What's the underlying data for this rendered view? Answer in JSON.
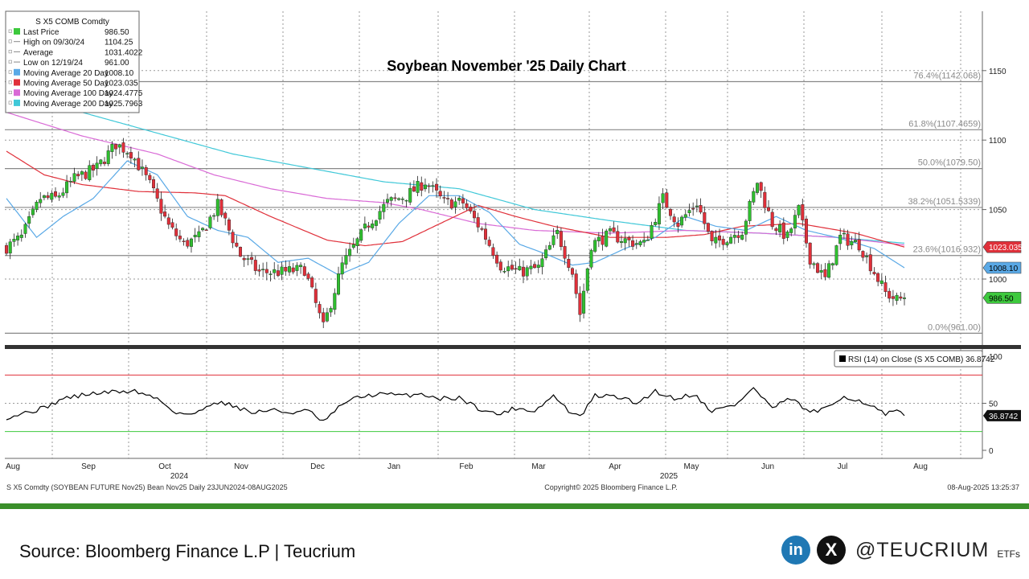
{
  "chart_data": {
    "type": "candlestick",
    "title": "Soybean November '25 Daily Chart",
    "ylim": [
      955,
      1160
    ],
    "y_ticks": [
      "1150",
      "1100",
      "1050",
      "1000"
    ],
    "x_months": [
      "Aug",
      "Sep",
      "Oct",
      "Nov",
      "Dec",
      "Jan",
      "Feb",
      "Mar",
      "Apr",
      "May",
      "Jun",
      "Jul",
      "Aug"
    ],
    "x_years": [
      "2024",
      "2025"
    ],
    "price_path": [
      {
        "t": 0,
        "v": 1023
      },
      {
        "t": 4,
        "v": 1030
      },
      {
        "t": 9,
        "v": 1058
      },
      {
        "t": 13,
        "v": 1058
      },
      {
        "t": 18,
        "v": 1072
      },
      {
        "t": 24,
        "v": 1080
      },
      {
        "t": 29,
        "v": 1097
      },
      {
        "t": 33,
        "v": 1091
      },
      {
        "t": 38,
        "v": 1068
      },
      {
        "t": 43,
        "v": 1038
      },
      {
        "t": 47,
        "v": 1025
      },
      {
        "t": 51,
        "v": 1030
      },
      {
        "t": 56,
        "v": 1053
      },
      {
        "t": 62,
        "v": 1017
      },
      {
        "t": 67,
        "v": 1005
      },
      {
        "t": 73,
        "v": 1005
      },
      {
        "t": 79,
        "v": 1007
      },
      {
        "t": 84,
        "v": 965
      },
      {
        "t": 89,
        "v": 1010
      },
      {
        "t": 96,
        "v": 1040
      },
      {
        "t": 101,
        "v": 1055
      },
      {
        "t": 106,
        "v": 1060
      },
      {
        "t": 111,
        "v": 1070
      },
      {
        "t": 116,
        "v": 1055
      },
      {
        "t": 121,
        "v": 1055
      },
      {
        "t": 126,
        "v": 1035
      },
      {
        "t": 131,
        "v": 1010
      },
      {
        "t": 136,
        "v": 1005
      },
      {
        "t": 141,
        "v": 1008
      },
      {
        "t": 146,
        "v": 1033
      },
      {
        "t": 150,
        "v": 1005
      },
      {
        "t": 152,
        "v": 975
      },
      {
        "t": 155,
        "v": 1025
      },
      {
        "t": 160,
        "v": 1032
      },
      {
        "t": 165,
        "v": 1027
      },
      {
        "t": 169,
        "v": 1025
      },
      {
        "t": 174,
        "v": 1058
      },
      {
        "t": 178,
        "v": 1040
      },
      {
        "t": 183,
        "v": 1055
      },
      {
        "t": 187,
        "v": 1025
      },
      {
        "t": 191,
        "v": 1030
      },
      {
        "t": 195,
        "v": 1035
      },
      {
        "t": 199,
        "v": 1070
      },
      {
        "t": 203,
        "v": 1040
      },
      {
        "t": 207,
        "v": 1030
      },
      {
        "t": 210,
        "v": 1050
      },
      {
        "t": 213,
        "v": 1015
      },
      {
        "t": 217,
        "v": 1000
      },
      {
        "t": 221,
        "v": 1030
      },
      {
        "t": 226,
        "v": 1025
      },
      {
        "t": 230,
        "v": 1005
      },
      {
        "t": 233,
        "v": 990
      },
      {
        "t": 236,
        "v": 985
      },
      {
        "t": 238,
        "v": 986.5
      }
    ],
    "moving_averages": [
      {
        "name": "20",
        "color": "#5aa9e6",
        "points": [
          {
            "t": 0,
            "v": 1058
          },
          {
            "t": 8,
            "v": 1030
          },
          {
            "t": 15,
            "v": 1045
          },
          {
            "t": 23,
            "v": 1058
          },
          {
            "t": 32,
            "v": 1085
          },
          {
            "t": 40,
            "v": 1075
          },
          {
            "t": 48,
            "v": 1045
          },
          {
            "t": 56,
            "v": 1035
          },
          {
            "t": 64,
            "v": 1030
          },
          {
            "t": 72,
            "v": 1012
          },
          {
            "t": 80,
            "v": 1015
          },
          {
            "t": 88,
            "v": 1003
          },
          {
            "t": 96,
            "v": 1012
          },
          {
            "t": 104,
            "v": 1040
          },
          {
            "t": 112,
            "v": 1060
          },
          {
            "t": 120,
            "v": 1060
          },
          {
            "t": 128,
            "v": 1048
          },
          {
            "t": 136,
            "v": 1025
          },
          {
            "t": 143,
            "v": 1018
          },
          {
            "t": 150,
            "v": 1010
          },
          {
            "t": 156,
            "v": 1012
          },
          {
            "t": 164,
            "v": 1022
          },
          {
            "t": 172,
            "v": 1030
          },
          {
            "t": 180,
            "v": 1045
          },
          {
            "t": 188,
            "v": 1038
          },
          {
            "t": 196,
            "v": 1035
          },
          {
            "t": 204,
            "v": 1045
          },
          {
            "t": 212,
            "v": 1035
          },
          {
            "t": 220,
            "v": 1030
          },
          {
            "t": 230,
            "v": 1022
          },
          {
            "t": 238,
            "v": 1008.1
          }
        ]
      },
      {
        "name": "50",
        "color": "#e0303a",
        "points": [
          {
            "t": 0,
            "v": 1092
          },
          {
            "t": 10,
            "v": 1075
          },
          {
            "t": 20,
            "v": 1068
          },
          {
            "t": 35,
            "v": 1063
          },
          {
            "t": 50,
            "v": 1062
          },
          {
            "t": 58,
            "v": 1060
          },
          {
            "t": 70,
            "v": 1045
          },
          {
            "t": 85,
            "v": 1028
          },
          {
            "t": 95,
            "v": 1024
          },
          {
            "t": 105,
            "v": 1027
          },
          {
            "t": 115,
            "v": 1040
          },
          {
            "t": 125,
            "v": 1053
          },
          {
            "t": 135,
            "v": 1045
          },
          {
            "t": 145,
            "v": 1038
          },
          {
            "t": 160,
            "v": 1030
          },
          {
            "t": 175,
            "v": 1030
          },
          {
            "t": 185,
            "v": 1032
          },
          {
            "t": 195,
            "v": 1038
          },
          {
            "t": 210,
            "v": 1040
          },
          {
            "t": 225,
            "v": 1033
          },
          {
            "t": 238,
            "v": 1023.035
          }
        ]
      },
      {
        "name": "100",
        "color": "#d96ad6",
        "points": [
          {
            "t": 0,
            "v": 1120
          },
          {
            "t": 20,
            "v": 1103
          },
          {
            "t": 40,
            "v": 1090
          },
          {
            "t": 55,
            "v": 1075
          },
          {
            "t": 70,
            "v": 1065
          },
          {
            "t": 85,
            "v": 1058
          },
          {
            "t": 100,
            "v": 1055
          },
          {
            "t": 110,
            "v": 1050
          },
          {
            "t": 125,
            "v": 1040
          },
          {
            "t": 140,
            "v": 1035
          },
          {
            "t": 160,
            "v": 1033
          },
          {
            "t": 180,
            "v": 1035
          },
          {
            "t": 200,
            "v": 1033
          },
          {
            "t": 220,
            "v": 1030
          },
          {
            "t": 238,
            "v": 1024.4775
          }
        ]
      },
      {
        "name": "200",
        "color": "#40c8d8",
        "points": [
          {
            "t": 0,
            "v": 1130
          },
          {
            "t": 20,
            "v": 1120
          },
          {
            "t": 40,
            "v": 1105
          },
          {
            "t": 60,
            "v": 1090
          },
          {
            "t": 80,
            "v": 1080
          },
          {
            "t": 100,
            "v": 1070
          },
          {
            "t": 120,
            "v": 1065
          },
          {
            "t": 140,
            "v": 1050
          },
          {
            "t": 160,
            "v": 1042
          },
          {
            "t": 180,
            "v": 1035
          },
          {
            "t": 200,
            "v": 1033
          },
          {
            "t": 220,
            "v": 1030
          },
          {
            "t": 238,
            "v": 1025.7963
          }
        ]
      }
    ],
    "fib_levels": [
      {
        "value": 1142.068,
        "label": "76.4%(1142.068)"
      },
      {
        "value": 1107.4659,
        "label": "61.8%(1107.4659)"
      },
      {
        "value": 1079.5,
        "label": "50.0%(1079.50)"
      },
      {
        "value": 1051.5339,
        "label": "38.2%(1051.5339)"
      },
      {
        "value": 1016.932,
        "label": "23.6%(1016.932)"
      },
      {
        "value": 961.0,
        "label": "0.0%(961.00)"
      }
    ],
    "price_tags": [
      {
        "label": "1023.035",
        "value": 1023.035,
        "bg": "#e0303a",
        "fg": "#ffffff"
      },
      {
        "label": "1008.10",
        "value": 1008.1,
        "bg": "#5aa9e6",
        "fg": "#000000"
      },
      {
        "label": "986.50",
        "value": 986.5,
        "bg": "#3dc93d",
        "fg": "#000000"
      }
    ],
    "rsi": {
      "label": "RSI (14)  on Close (S X5 COMB) 36.8742",
      "last_tag": "36.8742",
      "y_ticks": [
        "100",
        "50",
        "0"
      ],
      "overbought": 80,
      "oversold": 20,
      "points": [
        {
          "t": 0,
          "v": 35
        },
        {
          "t": 5,
          "v": 40
        },
        {
          "t": 10,
          "v": 45
        },
        {
          "t": 15,
          "v": 55
        },
        {
          "t": 22,
          "v": 60
        },
        {
          "t": 28,
          "v": 62
        },
        {
          "t": 34,
          "v": 63
        },
        {
          "t": 40,
          "v": 55
        },
        {
          "t": 45,
          "v": 40
        },
        {
          "t": 50,
          "v": 38
        },
        {
          "t": 55,
          "v": 52
        },
        {
          "t": 60,
          "v": 48
        },
        {
          "t": 65,
          "v": 40
        },
        {
          "t": 70,
          "v": 43
        },
        {
          "t": 75,
          "v": 40
        },
        {
          "t": 80,
          "v": 42
        },
        {
          "t": 84,
          "v": 30
        },
        {
          "t": 90,
          "v": 52
        },
        {
          "t": 95,
          "v": 58
        },
        {
          "t": 100,
          "v": 60
        },
        {
          "t": 105,
          "v": 58
        },
        {
          "t": 110,
          "v": 60
        },
        {
          "t": 115,
          "v": 55
        },
        {
          "t": 120,
          "v": 56
        },
        {
          "t": 125,
          "v": 45
        },
        {
          "t": 130,
          "v": 38
        },
        {
          "t": 135,
          "v": 45
        },
        {
          "t": 140,
          "v": 42
        },
        {
          "t": 145,
          "v": 58
        },
        {
          "t": 149,
          "v": 42
        },
        {
          "t": 152,
          "v": 35
        },
        {
          "t": 156,
          "v": 58
        },
        {
          "t": 162,
          "v": 57
        },
        {
          "t": 167,
          "v": 50
        },
        {
          "t": 172,
          "v": 63
        },
        {
          "t": 177,
          "v": 55
        },
        {
          "t": 182,
          "v": 60
        },
        {
          "t": 187,
          "v": 42
        },
        {
          "t": 193,
          "v": 48
        },
        {
          "t": 198,
          "v": 66
        },
        {
          "t": 203,
          "v": 45
        },
        {
          "t": 208,
          "v": 55
        },
        {
          "t": 213,
          "v": 40
        },
        {
          "t": 218,
          "v": 45
        },
        {
          "t": 222,
          "v": 58
        },
        {
          "t": 228,
          "v": 50
        },
        {
          "t": 233,
          "v": 38
        },
        {
          "t": 236,
          "v": 42
        },
        {
          "t": 238,
          "v": 36.87
        }
      ]
    },
    "legend": {
      "title": "S X5 COMB Comdty",
      "rows": [
        {
          "label": "Last Price",
          "value": "986.50",
          "color": "#3dc93d"
        },
        {
          "label": "High on 09/30/24",
          "value": "1104.25",
          "color": ""
        },
        {
          "label": "Average",
          "value": "1031.4022",
          "color": ""
        },
        {
          "label": "Low on 12/19/24",
          "value": "961.00",
          "color": ""
        },
        {
          "label": "Moving Average 20 Day",
          "value": "1008.10",
          "color": "#5aa9e6"
        },
        {
          "label": "Moving Average 50 Day",
          "value": "1023.035",
          "color": "#e0303a"
        },
        {
          "label": "Moving Average 100 Day",
          "value": "1024.4775",
          "color": "#d96ad6"
        },
        {
          "label": "Moving Average 200 Day",
          "value": "1025.7963",
          "color": "#40c8d8"
        }
      ]
    },
    "footer_left": "S X5 Comdty (SOYBEAN FUTURE    Nov25) Bean Nov25  Daily 23JUN2024-08AUG2025",
    "footer_center": "Copyright© 2025 Bloomberg Finance L.P.",
    "footer_right": "08-Aug-2025 13:25:37"
  },
  "source_text": "Source: Bloomberg Finance L.P | Teucrium",
  "social": {
    "linkedin": "in",
    "x": "X",
    "handle": "@TEUCRIUM",
    "suffix": "ETFs"
  },
  "colors": {
    "up": "#2fbf2f",
    "down": "#e0303a",
    "frame_green": "#3a8f2a"
  }
}
